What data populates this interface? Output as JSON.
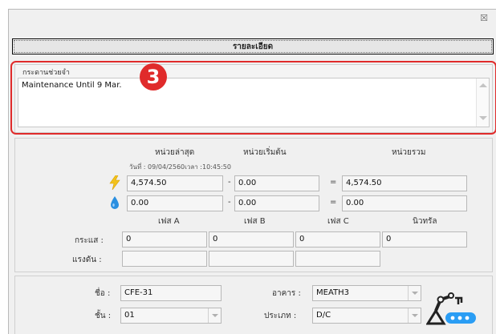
{
  "window": {
    "close_glyph": "☒"
  },
  "header": {
    "title": "รายละเอียด"
  },
  "memo": {
    "label": "กระดานช่วยจำ",
    "text": "Maintenance Until 9 Mar.",
    "badge": "3"
  },
  "meter": {
    "col_latest": "หน่วยล่าสุด",
    "col_start": "หน่วยเริ่มต้น",
    "col_total": "หน่วยรวม",
    "timestamp": "วันที่ : 09/04/2560เวลา :10:45:50",
    "energy": {
      "latest": "4,574.50",
      "start": "0.00",
      "total": "4,574.50"
    },
    "water": {
      "latest": "0.00",
      "start": "0.00",
      "total": "0.00"
    },
    "minus": "-",
    "equals": "=",
    "phase_a": "เฟส A",
    "phase_b": "เฟส B",
    "phase_c": "เฟส C",
    "neutral": "นิวทรัล",
    "current_label": "กระแส :",
    "voltage_label": "แรงดัน :",
    "current": {
      "a": "0",
      "b": "0",
      "c": "0",
      "n": "0"
    },
    "voltage": {
      "a": "",
      "b": "",
      "c": ""
    }
  },
  "info": {
    "name_label": "ชื่อ :",
    "name": "CFE-31",
    "building_label": "อาคาร :",
    "building": "MEATH3",
    "floor_label": "ชั้น :",
    "floor": "01",
    "type_label": "ประเภท :",
    "type": "D/C"
  },
  "colors": {
    "accent_red": "#e02b2b",
    "energy_yellow": "#f2c21b",
    "water_blue": "#2a8fe0",
    "device_blue": "#2a9df4"
  },
  "icons": [
    "lightning-icon",
    "water-drop-icon",
    "device-icon",
    "close-icon",
    "scroll-up-icon",
    "scroll-down-icon",
    "chevron-down-icon"
  ]
}
